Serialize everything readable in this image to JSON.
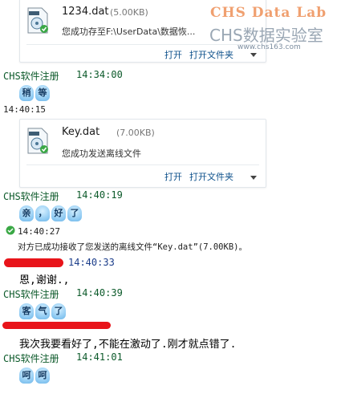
{
  "watermark": {
    "line1": "CHS Data Lab",
    "line2": "CHS数据实验室",
    "url": "www.chs163.com",
    "line1_color": "#f0a070"
  },
  "files": [
    {
      "icon": "vcd-file-check-icon",
      "name": "1234.dat",
      "size": "(5.00KB)",
      "status": "您成功存至F:\\UserData\\数据恢...",
      "action_open": "打开",
      "action_open_folder": "打开文件夹"
    },
    {
      "icon": "vcd-file-check-icon",
      "name": "Key.dat",
      "size": "(7.00KB)",
      "status": "您成功发送离线文件",
      "action_open": "打开",
      "action_open_folder": "打开文件夹"
    }
  ],
  "chat": {
    "m1_sender": "CHS软件注册",
    "m1_time": "14:34:00",
    "m1_emoticon": [
      "稍",
      "等"
    ],
    "stamp1": "14:40:15",
    "m2_sender": "CHS软件注册",
    "m2_time": "14:40:19",
    "m2_emoticon": [
      "亲",
      "，",
      "好",
      "了"
    ],
    "stamp2": "14:40:27",
    "system_notice": "对方已成功接收了您发送的离线文件“Key.dat”(7.00KB)。",
    "m3_time": "14:40:33",
    "m3_text": "恩,谢谢.,",
    "m4_sender": "CHS软件注册",
    "m4_time": "14:40:39",
    "m4_emoticon": [
      "客",
      "气",
      "了"
    ],
    "m5_text": "我次我要看好了,不能在激动了.刚才就点错了.",
    "m6_sender": "CHS软件注册",
    "m6_time": "14:41:01",
    "m6_emoticon": [
      "呵",
      "呵"
    ]
  },
  "colors": {
    "sender": "#0c5a2a",
    "link": "#0b4f8a",
    "redaction": "#e8141a",
    "success_badge": "#3aa845"
  }
}
